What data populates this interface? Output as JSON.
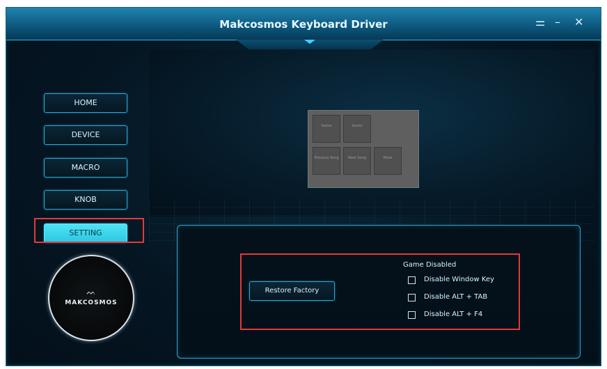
{
  "window": {
    "title": "Makcosmos Keyboard Driver",
    "controls": {
      "menu": "⚌",
      "minimize": "–",
      "close": "✕"
    }
  },
  "sidebar": {
    "items": [
      {
        "label": "HOME",
        "active": false
      },
      {
        "label": "DEVICE",
        "active": false
      },
      {
        "label": "MACRO",
        "active": false
      },
      {
        "label": "KNOB",
        "active": false
      },
      {
        "label": "SETTING",
        "active": true
      }
    ]
  },
  "logo": {
    "mark": "ᨓ",
    "text": "MAKCOSMOS"
  },
  "device_preview": {
    "keys": [
      {
        "label": "Game"
      },
      {
        "label": "Game"
      },
      {
        "label": "Previous Song"
      },
      {
        "label": "Next Song"
      },
      {
        "label": "Mute"
      }
    ]
  },
  "settings": {
    "restore_label": "Restore Factory",
    "group_title": "Game Disabled",
    "options": [
      {
        "label": "Disable Window Key",
        "checked": false
      },
      {
        "label": "Disable ALT + TAB",
        "checked": false
      },
      {
        "label": "Disable ALT + F4",
        "checked": false
      }
    ]
  },
  "colors": {
    "accent": "#2ea9d6",
    "active_tab": "#4fe3f3",
    "highlight_box": "#e23a3a"
  }
}
